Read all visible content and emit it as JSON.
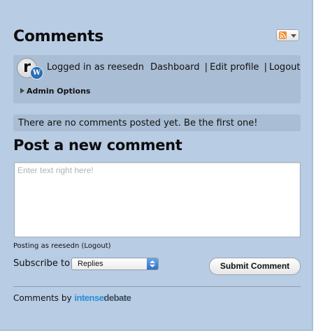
{
  "header": {
    "title": "Comments",
    "feed_icon": "rss-icon"
  },
  "user": {
    "avatar_letter": "r",
    "badge_letter": "W",
    "logged_in_text": "Logged in as reesedn",
    "links": {
      "dashboard": "Dashboard",
      "edit_profile": "Edit profile",
      "logout": "Logout",
      "separator": "|"
    },
    "admin_options": "Admin Options"
  },
  "comments": {
    "empty_message": "There are no comments posted yet. Be the first one!"
  },
  "post": {
    "title": "Post a new comment",
    "textarea_placeholder": "Enter text right here!",
    "posting_as": "Posting as reesedn (Logout)",
    "subscribe_label": "Subscribe to",
    "subscribe_selected": "Replies",
    "submit_label": "Submit Comment"
  },
  "footer": {
    "comments_by": "Comments by",
    "brand_part1": "intense",
    "brand_part2": "debate"
  },
  "colors": {
    "panel_bg": "#b8cce4",
    "box_bg": "#a9bdd4",
    "brand_accent": "#2a8fd8",
    "rss_orange": "#f28b2c"
  }
}
